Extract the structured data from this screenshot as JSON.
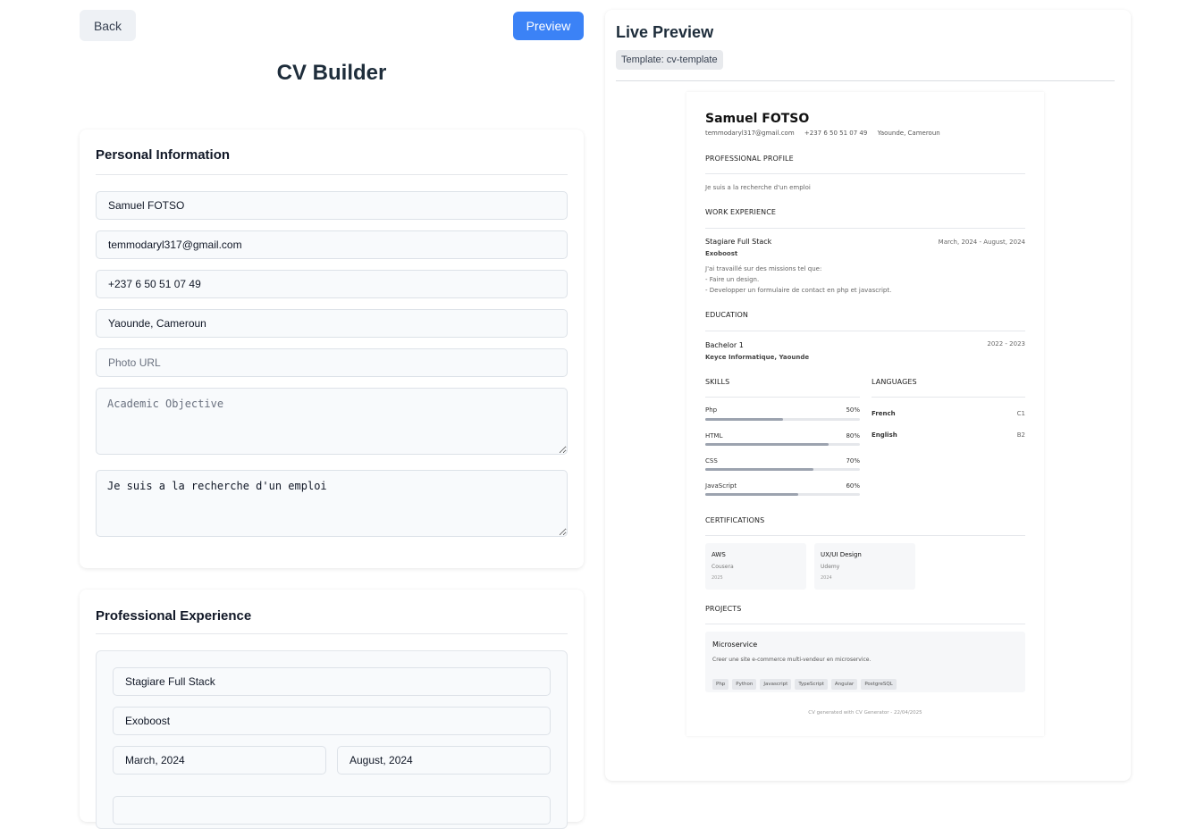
{
  "header": {
    "back_label": "Back",
    "preview_label": "Preview",
    "title": "CV Builder"
  },
  "personal": {
    "heading": "Personal Information",
    "name": "Samuel FOTSO",
    "email": "temmodaryl317@gmail.com",
    "phone": "+237 6 50 51 07 49",
    "location": "Yaounde, Cameroun",
    "photo_placeholder": "Photo URL",
    "objective_placeholder": "Academic Objective",
    "summary": "Je suis a la recherche d'un emploi"
  },
  "experience_form": {
    "heading": "Professional Experience",
    "position": "Stagiare Full Stack",
    "company": "Exoboost",
    "start": "March, 2024",
    "end": "August, 2024"
  },
  "preview": {
    "title": "Live Preview",
    "template": "Template: cv-template",
    "cv": {
      "name": "Samuel FOTSO",
      "email": "temmodaryl317@gmail.com",
      "phone": "+237 6 50 51 07 49",
      "location": "Yaounde, Cameroun",
      "profile_heading": "PROFESSIONAL PROFILE",
      "profile_text": "Je suis a la recherche d'un emploi",
      "work_heading": "WORK EXPERIENCE",
      "work": {
        "title": "Stagiare Full Stack",
        "company": "Exoboost",
        "dates": "March, 2024 - August, 2024",
        "desc1": "J'ai travaillé sur des missions tel que:",
        "desc2": "- Faire un design.",
        "desc3": "- Developper un formulaire de contact en php et javascript."
      },
      "education_heading": "EDUCATION",
      "education": {
        "degree": "Bachelor 1",
        "school": "Keyce Informatique, Yaounde",
        "dates": "2022 - 2023"
      },
      "skills_heading": "SKILLS",
      "skills": [
        {
          "name": "Php",
          "pct": "50%",
          "level": 50
        },
        {
          "name": "HTML",
          "pct": "80%",
          "level": 80
        },
        {
          "name": "CSS",
          "pct": "70%",
          "level": 70
        },
        {
          "name": "JavaScript",
          "pct": "60%",
          "level": 60
        }
      ],
      "languages_heading": "LANGUAGES",
      "languages": [
        {
          "name": "French",
          "level": "C1"
        },
        {
          "name": "English",
          "level": "B2"
        }
      ],
      "certifications_heading": "CERTIFICATIONS",
      "certifications": [
        {
          "name": "AWS",
          "issuer": "Cousera",
          "year": "2025"
        },
        {
          "name": "UX/UI Design",
          "issuer": "Udemy",
          "year": "2024"
        }
      ],
      "projects_heading": "PROJECTS",
      "project": {
        "name": "Microservice",
        "desc": "Creer une site e-commerce multi-vendeur en microservice.",
        "tags": [
          "Php",
          "Python",
          "Javascript",
          "TypeScript",
          "Angular",
          "PostgreSQL"
        ]
      },
      "footer": "CV generated with CV Generator - 22/04/2025"
    }
  },
  "colors": {
    "accent": "#3b82f6",
    "heading": "#1e2d3b"
  }
}
